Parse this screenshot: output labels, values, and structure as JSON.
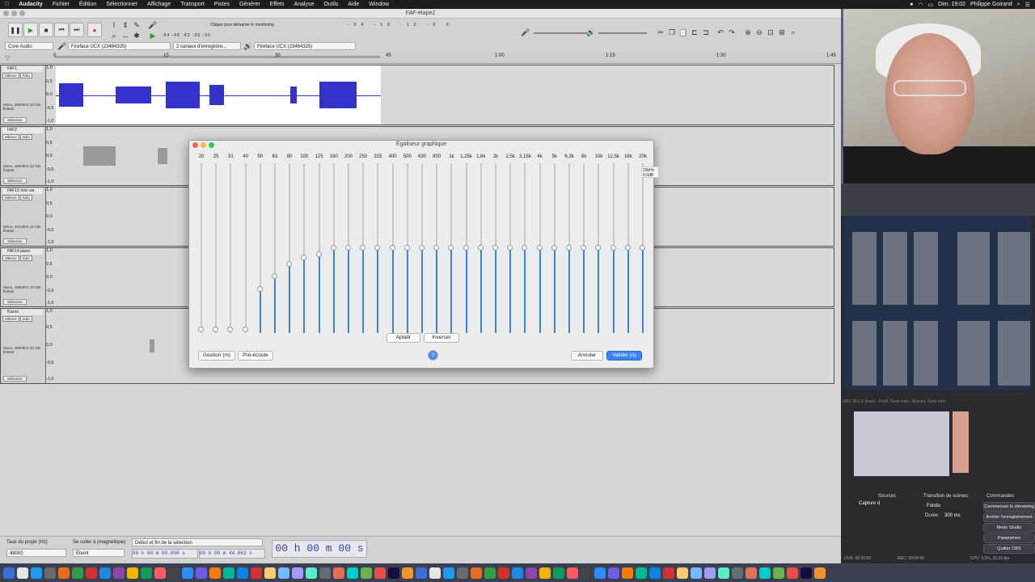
{
  "menubar": {
    "apple": "",
    "items": [
      "Audacity",
      "Fichier",
      "Édition",
      "Sélectionner",
      "Affichage",
      "Transport",
      "Pistes",
      "Générer",
      "Effets",
      "Analyse",
      "Outils",
      "Aide",
      "Window"
    ],
    "clock": "Dim. 19:02",
    "user": "Philippe Goirand"
  },
  "window": {
    "title": "FAF-étape2"
  },
  "toolbar": {
    "monitor_hint": "Cliquer pour démarrer le monitoring",
    "meter_ticks": [
      "-54",
      "-48",
      "-42",
      "-36",
      "-30",
      "-24",
      "-18",
      "-12",
      "-6",
      "0"
    ]
  },
  "devices": {
    "host": "Core Audio",
    "input": "Fireface UCX (23464325)",
    "channels": "2 canaux d'enregistre...",
    "output": "Fireface UCX (23464325)"
  },
  "ruler": {
    "ticks": [
      "0",
      "15",
      "30",
      "45",
      "1:00",
      "1:15",
      "1:30",
      "1:45"
    ]
  },
  "tracks": [
    {
      "name": "FAF1",
      "format": "Mono, 48000Hz\n32 bits flottant"
    },
    {
      "name": "FAF2",
      "format": "Mono, 48000Hz\n32 bits flottant"
    },
    {
      "name": "FAF13 Voix wa",
      "format": "Mono, 44100Hz\n32 bits flottant"
    },
    {
      "name": "FAF14 piano",
      "format": "Mono, 48000Hz\n32 bits flottant"
    },
    {
      "name": "Kazoo",
      "format": "Mono, 48000Hz\n32 bits flottant"
    }
  ],
  "track_labels": {
    "mute": "Silence",
    "solo": "Solo",
    "select": "Sélection"
  },
  "scale": [
    "1,0",
    "0,5",
    "0,0",
    "-0,5",
    "-1,0"
  ],
  "eq": {
    "title": "Égaliseur graphique",
    "bands": [
      {
        "freq": "20",
        "gain": -1.0
      },
      {
        "freq": "25",
        "gain": -1.0
      },
      {
        "freq": "31",
        "gain": -1.0
      },
      {
        "freq": "40",
        "gain": -1.0
      },
      {
        "freq": "50",
        "gain": -0.5
      },
      {
        "freq": "63",
        "gain": -0.35
      },
      {
        "freq": "80",
        "gain": -0.2
      },
      {
        "freq": "100",
        "gain": -0.12
      },
      {
        "freq": "125",
        "gain": -0.08
      },
      {
        "freq": "160",
        "gain": 0
      },
      {
        "freq": "200",
        "gain": 0
      },
      {
        "freq": "250",
        "gain": 0
      },
      {
        "freq": "315",
        "gain": 0
      },
      {
        "freq": "400",
        "gain": 0
      },
      {
        "freq": "500",
        "gain": 0
      },
      {
        "freq": "630",
        "gain": 0
      },
      {
        "freq": "800",
        "gain": 0
      },
      {
        "freq": "1k",
        "gain": 0
      },
      {
        "freq": "1,25k",
        "gain": 0
      },
      {
        "freq": "1,6k",
        "gain": 0
      },
      {
        "freq": "2k",
        "gain": 0
      },
      {
        "freq": "2,5k",
        "gain": 0
      },
      {
        "freq": "3,15k",
        "gain": 0
      },
      {
        "freq": "4k",
        "gain": 0
      },
      {
        "freq": "5k",
        "gain": 0
      },
      {
        "freq": "6,3k",
        "gain": 0
      },
      {
        "freq": "8k",
        "gain": 0
      },
      {
        "freq": "10k",
        "gain": 0
      },
      {
        "freq": "12,5k",
        "gain": 0
      },
      {
        "freq": "16k",
        "gain": 0
      },
      {
        "freq": "20k",
        "gain": 0
      }
    ],
    "tooltip": "20kHz\n0,0dB",
    "flatten": "Aplatir",
    "invert": "Inverser",
    "manage": "Gestion (m)",
    "preview": "Pré-écoute",
    "cancel": "Annuler",
    "ok": "Valider (o)",
    "help": "?"
  },
  "bottom": {
    "rate_label": "Taux du projet (Hz)",
    "rate_value": "48000",
    "snap_label": "Se coller à (magnétique)",
    "snap_value": "Éteint",
    "range_mode": "Début et fin de la sélection",
    "sel_start": "00 h 00 m 00.000 s",
    "sel_end": "00 h 00 m 44.062 s",
    "position": "00 h 00 m 00 s"
  },
  "obs": {
    "title": "OBS 26.0.2 (mac) - Profil: Sans nom - Scènes: Sans nom",
    "sources_header": "Sources",
    "source_item": "Capture d",
    "transition_header": "Transition de scènes",
    "transition_value": "Fondu",
    "duration_label": "Durée",
    "duration_value": "300 ms",
    "controls_header": "Commandes",
    "controls": [
      "Commencer le streaming",
      "Arrêter l'enregistrement",
      "Mode Studio",
      "Paramètres",
      "Quitter OBS"
    ],
    "status": "CPU: 3,2%, 30,00 fps",
    "rec": "REC: 00:09:43",
    "live": "LIVE: 00:00:00"
  },
  "colors": {
    "accent": "#3a82f6",
    "wave": "#3333cc",
    "eq_fill": "#3b84e0",
    "record": "#d23030"
  }
}
